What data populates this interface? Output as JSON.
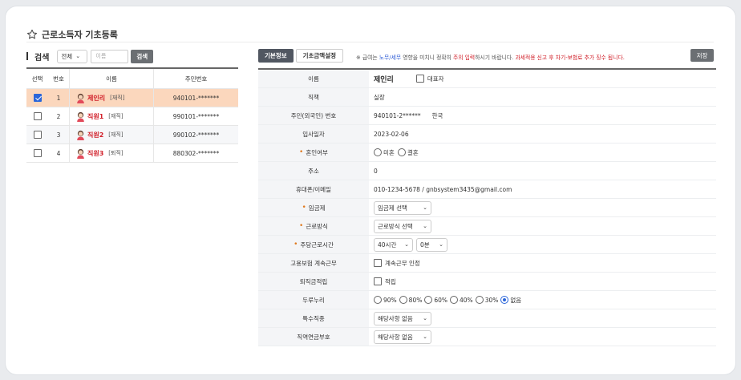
{
  "header": {
    "title": "근로소득자 기초등록",
    "icon": "star-outline-icon"
  },
  "search": {
    "label": "검색",
    "scope_value": "전체",
    "name_placeholder": "이름",
    "button": "검색"
  },
  "employee_table": {
    "columns": [
      "선택",
      "번호",
      "이름",
      "주민번호"
    ],
    "rows": [
      {
        "selected": true,
        "no": "1",
        "name": "제인리",
        "status": "[재직]",
        "rrn": "940101-*******"
      },
      {
        "selected": false,
        "no": "2",
        "name": "직원1",
        "status": "[재직]",
        "rrn": "990101-*******"
      },
      {
        "selected": false,
        "no": "3",
        "name": "직원2",
        "status": "[재직]",
        "rrn": "990102-*******"
      },
      {
        "selected": false,
        "no": "4",
        "name": "직원3",
        "status": "[퇴직]",
        "rrn": "880302-*******"
      }
    ]
  },
  "tabs": [
    {
      "label": "기본정보",
      "active": true
    },
    {
      "label": "기초금액설정",
      "active": false
    }
  ],
  "notice": {
    "p1": "※ 급여는 ",
    "p2": "노무/세무",
    "p3": " 영향을 미치니 정확히 ",
    "p4": "주의 입력",
    "p5": "하시기 바랍니다. ",
    "p6": "과세적용 신고 후 차기-보험료 추가 징수 됩니다."
  },
  "save_button": "저장",
  "form": {
    "name": {
      "label": "이름",
      "value": "제인리",
      "rep_label": "대표자"
    },
    "position": {
      "label": "직책",
      "value": "실장"
    },
    "rrn": {
      "label": "주민(외국인) 번호",
      "value": "940101-2******",
      "nation": "한국"
    },
    "join_date": {
      "label": "입사일자",
      "value": "2023-02-06"
    },
    "marital": {
      "label": "혼인여부",
      "options": [
        "미혼",
        "결혼"
      ]
    },
    "address": {
      "label": "주소",
      "value": "0"
    },
    "contact": {
      "label": "휴대폰/이메일",
      "value": "010-1234-5678 / gnbsystem3435@gmail.com"
    },
    "wage_type": {
      "label": "임금제",
      "value": "임금제 선택"
    },
    "work_type": {
      "label": "근로방식",
      "value": "근로방식 선택"
    },
    "weekly_hours": {
      "label": "주당근로시간",
      "hours": "40시간",
      "minutes": "0분"
    },
    "emp_ins": {
      "label": "고용보험 계속근무",
      "check_label": "계속근무 인정"
    },
    "retirement": {
      "label": "퇴직금적립",
      "check_label": "적립"
    },
    "durunuri": {
      "label": "두루누리",
      "options": [
        "90%",
        "80%",
        "60%",
        "40%",
        "30%",
        "없음"
      ],
      "selected": "없음"
    },
    "special_job": {
      "label": "특수직종",
      "value": "해당사항 없음"
    },
    "pension": {
      "label": "직역연금부호",
      "value": "해당사항 없음"
    }
  },
  "colors": {
    "selected_row": "#fbd7bd",
    "accent_red": "#d1202a",
    "accent_blue": "#2e5cd6",
    "required": "#e07a1f"
  }
}
